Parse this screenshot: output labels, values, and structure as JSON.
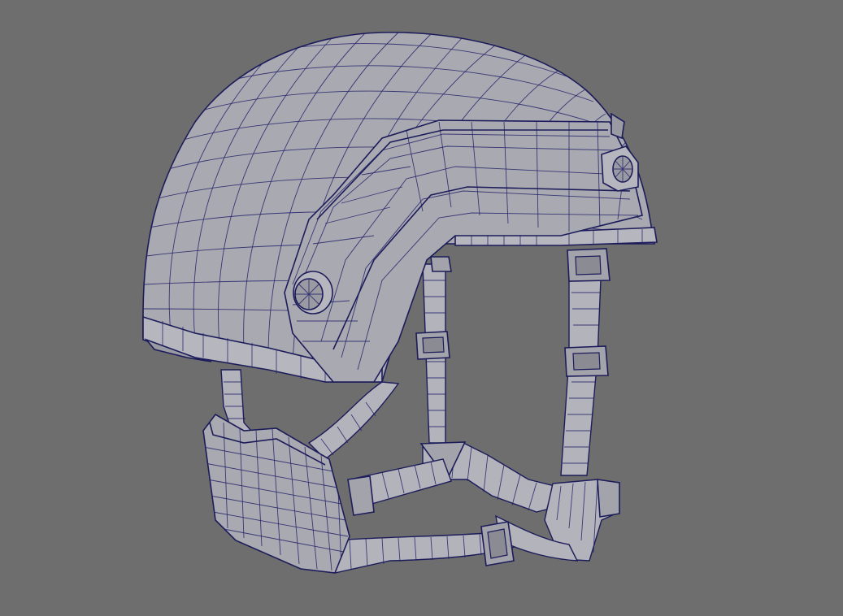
{
  "viewport": {
    "background_color": "#6e6e6e",
    "mesh_fill_color": "#a9a9b1",
    "wireframe_color": "#1c1c5a",
    "subject": "helmet-wireframe-model"
  }
}
